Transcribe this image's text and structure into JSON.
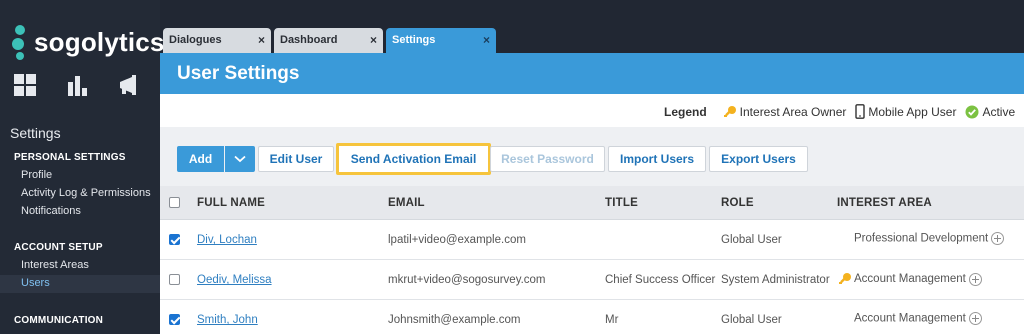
{
  "app": {
    "logo_text": "sogolytics"
  },
  "tabs": [
    {
      "label": "Dialogues",
      "close": "×"
    },
    {
      "label": "Dashboard",
      "close": "×"
    },
    {
      "label": "Settings",
      "close": "×"
    }
  ],
  "sidebar": {
    "title": "Settings",
    "sections": [
      {
        "heading": "PERSONAL SETTINGS",
        "items": [
          "Profile",
          "Activity Log & Permissions",
          "Notifications"
        ]
      },
      {
        "heading": "ACCOUNT SETUP",
        "items": [
          "Interest Areas",
          "Users"
        ]
      },
      {
        "heading": "COMMUNICATION"
      }
    ],
    "active_item": "Users"
  },
  "header": {
    "title": "User Settings"
  },
  "legend": {
    "label": "Legend",
    "items": [
      {
        "icon": "key-icon",
        "label": "Interest Area Owner"
      },
      {
        "icon": "mobile-icon",
        "label": "Mobile App User"
      },
      {
        "icon": "check-circle-icon",
        "label": "Active"
      }
    ]
  },
  "toolbar": {
    "add": "Add",
    "edit_user": "Edit User",
    "send_activation": "Send Activation Email",
    "reset_password": "Reset Password",
    "import_users": "Import Users",
    "export_users": "Export Users"
  },
  "table": {
    "columns": [
      "FULL NAME",
      "EMAIL",
      "TITLE",
      "ROLE",
      "INTEREST AREA"
    ],
    "rows": [
      {
        "checked": true,
        "name": "Div, Lochan",
        "email": "lpatil+video@example.com",
        "title": "",
        "role": "Global User",
        "interest_area": "Professional Development",
        "owner": false
      },
      {
        "checked": false,
        "name": "Oediv, Melissa",
        "email": "mkrut+video@sogosurvey.com",
        "title": "Chief Success Officer",
        "role": "System Administrator",
        "interest_area": "Account Management",
        "owner": true
      },
      {
        "checked": true,
        "name": "Smith, John",
        "email": "Johnsmith@example.com",
        "title": "Mr",
        "role": "Global User",
        "interest_area": "Account Management",
        "owner": false
      }
    ]
  },
  "colors": {
    "accent": "#3a9ad9",
    "sidebar": "#232a36",
    "highlight": "#f6c43c",
    "active_green": "#7cc242",
    "key_gold": "#f4b21f"
  }
}
